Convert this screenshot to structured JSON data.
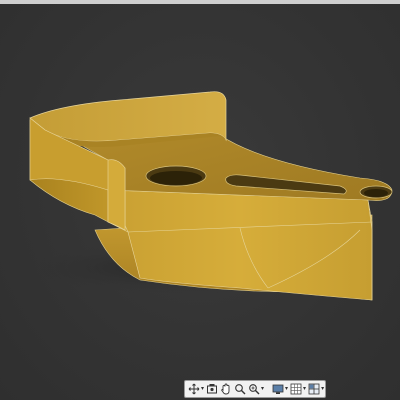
{
  "viewport": {
    "background_color": "#353535",
    "model_color": "#c49a2a",
    "edge_color": "#e8d59a"
  },
  "toolbar": {
    "buttons": [
      {
        "name": "orbit",
        "icon": "orbit-icon",
        "has_dropdown": true
      },
      {
        "name": "look-at",
        "icon": "look-at-icon",
        "has_dropdown": false
      },
      {
        "name": "pan",
        "icon": "pan-hand-icon",
        "has_dropdown": false
      },
      {
        "name": "zoom",
        "icon": "zoom-icon",
        "has_dropdown": false
      },
      {
        "name": "fit",
        "icon": "fit-zoom-icon",
        "has_dropdown": true
      },
      {
        "name": "display-settings",
        "icon": "display-settings-icon",
        "has_dropdown": true
      },
      {
        "name": "grid-snaps",
        "icon": "grid-icon",
        "has_dropdown": true
      },
      {
        "name": "viewports",
        "icon": "viewports-icon",
        "has_dropdown": true
      }
    ]
  }
}
